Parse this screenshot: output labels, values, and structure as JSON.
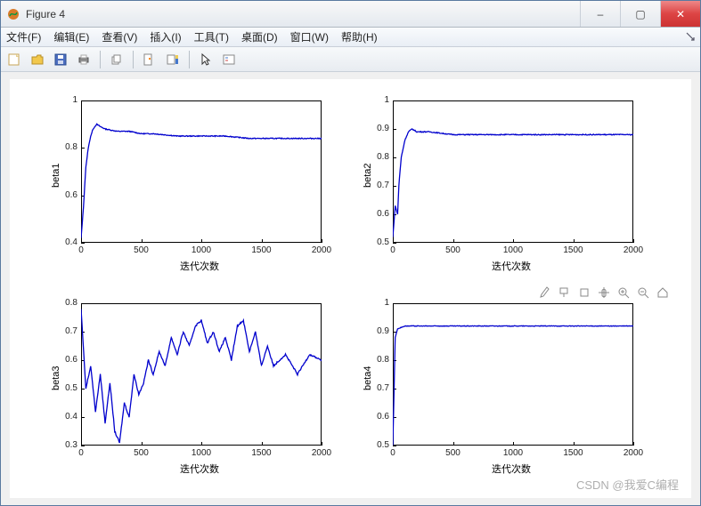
{
  "window": {
    "title": "Figure 4",
    "buttons": {
      "min": "–",
      "max": "▢",
      "close": "✕"
    }
  },
  "menu": {
    "file": "文件(F)",
    "edit": "编辑(E)",
    "view": "查看(V)",
    "insert": "插入(I)",
    "tools": "工具(T)",
    "desktop": "桌面(D)",
    "window": "窗口(W)",
    "help": "帮助(H)"
  },
  "toolbar": {
    "new": "new-figure",
    "open": "open",
    "save": "save",
    "print": "print",
    "copy": "copy",
    "datacursor": "data-cursor",
    "colorbar": "insert-colorbar",
    "pointer": "pointer",
    "legend": "insert-legend"
  },
  "hover_tools": [
    "brush-icon",
    "datatip-icon",
    "pan-icon",
    "zoom-in-icon",
    "zoom-out-icon",
    "home-icon"
  ],
  "xlabel_common": "迭代次数",
  "watermark": "CSDN @我爱C编程",
  "chart_data": [
    {
      "type": "line",
      "title": "",
      "xlabel": "迭代次数",
      "ylabel": "beta1",
      "xlim": [
        0,
        2000
      ],
      "ylim": [
        0.4,
        1.0
      ],
      "xticks": [
        0,
        500,
        1000,
        1500,
        2000
      ],
      "yticks": [
        0.4,
        0.6,
        0.8,
        1.0
      ],
      "series": [
        {
          "name": "beta1",
          "color": "#0000cd",
          "x": [
            0,
            20,
            40,
            60,
            80,
            100,
            130,
            160,
            200,
            300,
            400,
            500,
            600,
            800,
            1000,
            1200,
            1400,
            1600,
            1800,
            2000
          ],
          "y": [
            0.42,
            0.55,
            0.72,
            0.8,
            0.85,
            0.88,
            0.9,
            0.89,
            0.88,
            0.87,
            0.87,
            0.86,
            0.86,
            0.85,
            0.85,
            0.85,
            0.84,
            0.84,
            0.84,
            0.84
          ]
        }
      ]
    },
    {
      "type": "line",
      "title": "",
      "xlabel": "迭代次数",
      "ylabel": "beta2",
      "xlim": [
        0,
        2000
      ],
      "ylim": [
        0.5,
        1.0
      ],
      "xticks": [
        0,
        500,
        1000,
        1500,
        2000
      ],
      "yticks": [
        0.5,
        0.6,
        0.7,
        0.8,
        0.9,
        1.0
      ],
      "series": [
        {
          "name": "beta2",
          "color": "#0000cd",
          "x": [
            0,
            20,
            40,
            50,
            70,
            100,
            130,
            160,
            200,
            300,
            500,
            800,
            1200,
            1600,
            2000
          ],
          "y": [
            0.52,
            0.63,
            0.6,
            0.7,
            0.8,
            0.86,
            0.89,
            0.9,
            0.89,
            0.89,
            0.88,
            0.88,
            0.88,
            0.88,
            0.88
          ]
        }
      ]
    },
    {
      "type": "line",
      "title": "",
      "xlabel": "迭代次数",
      "ylabel": "beta3",
      "xlim": [
        0,
        2000
      ],
      "ylim": [
        0.3,
        0.8
      ],
      "xticks": [
        0,
        500,
        1000,
        1500,
        2000
      ],
      "yticks": [
        0.3,
        0.4,
        0.5,
        0.6,
        0.7,
        0.8
      ],
      "series": [
        {
          "name": "beta3",
          "color": "#0000cd",
          "x": [
            0,
            40,
            80,
            120,
            160,
            200,
            240,
            280,
            320,
            360,
            400,
            440,
            480,
            520,
            560,
            600,
            650,
            700,
            750,
            800,
            850,
            900,
            950,
            1000,
            1050,
            1100,
            1150,
            1200,
            1250,
            1300,
            1350,
            1400,
            1450,
            1500,
            1550,
            1600,
            1700,
            1800,
            1900,
            2000
          ],
          "y": [
            0.78,
            0.5,
            0.58,
            0.42,
            0.55,
            0.38,
            0.52,
            0.35,
            0.31,
            0.45,
            0.4,
            0.55,
            0.48,
            0.52,
            0.6,
            0.55,
            0.63,
            0.58,
            0.68,
            0.62,
            0.7,
            0.65,
            0.72,
            0.74,
            0.66,
            0.7,
            0.63,
            0.68,
            0.6,
            0.72,
            0.74,
            0.63,
            0.7,
            0.58,
            0.65,
            0.58,
            0.62,
            0.55,
            0.62,
            0.6
          ]
        }
      ]
    },
    {
      "type": "line",
      "title": "",
      "xlabel": "迭代次数",
      "ylabel": "beta4",
      "xlim": [
        0,
        2000
      ],
      "ylim": [
        0.5,
        1.0
      ],
      "xticks": [
        0,
        500,
        1000,
        1500,
        2000
      ],
      "yticks": [
        0.5,
        0.6,
        0.7,
        0.8,
        0.9,
        1.0
      ],
      "series": [
        {
          "name": "beta4",
          "color": "#0000cd",
          "x": [
            0,
            20,
            40,
            100,
            200,
            400,
            700,
            1000,
            1300,
            1600,
            2000
          ],
          "y": [
            0.5,
            0.88,
            0.91,
            0.92,
            0.92,
            0.92,
            0.92,
            0.92,
            0.92,
            0.92,
            0.92
          ]
        }
      ]
    }
  ]
}
